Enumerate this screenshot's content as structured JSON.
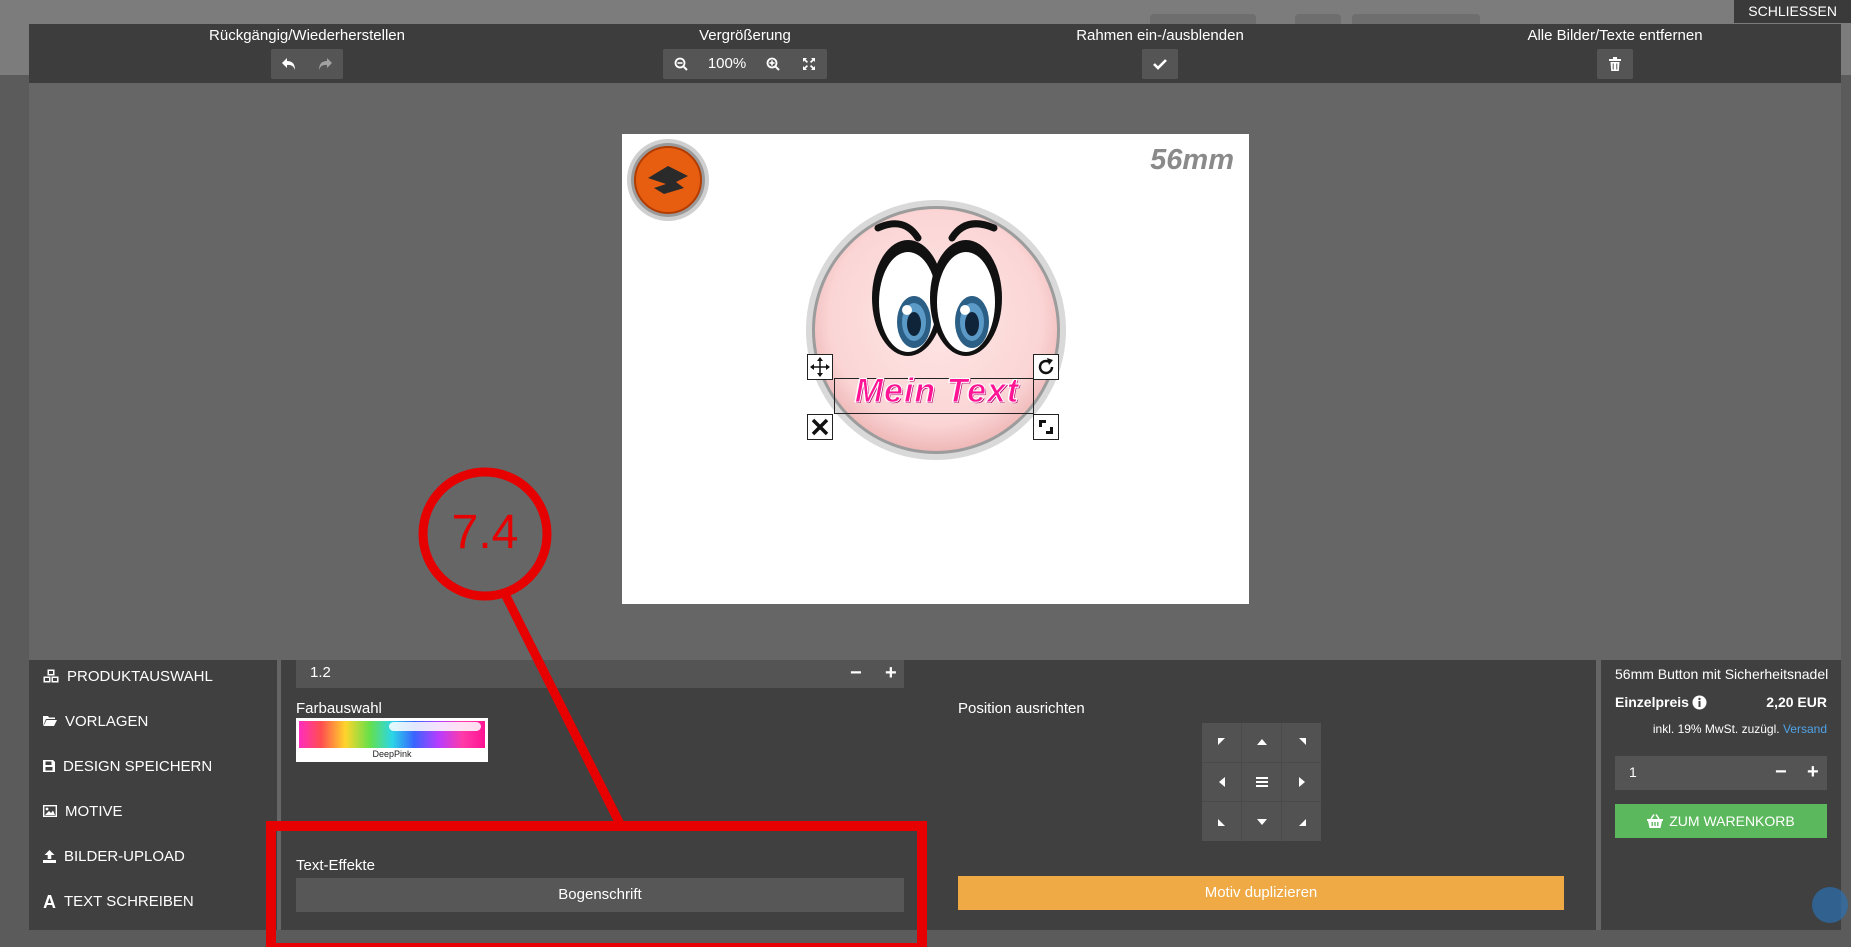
{
  "topbar": {
    "close_label": "SCHLIESSEN"
  },
  "toolbar": {
    "undo_group_label": "Rückgängig/Wiederherstellen",
    "zoom_group_label": "Vergrößerung",
    "zoom_value": "100%",
    "frame_group_label": "Rahmen ein-/ausblenden",
    "clear_group_label": "Alle Bilder/Texte entfernen"
  },
  "canvas": {
    "size_label": "56mm",
    "text_object": "Mein Text",
    "text_color": "#ff1493"
  },
  "menu": {
    "items": [
      {
        "label": "PRODUKTAUSWAHL",
        "icon": "cubes-icon"
      },
      {
        "label": "VORLAGEN",
        "icon": "folder-open-icon"
      },
      {
        "label": "DESIGN SPEICHERN",
        "icon": "save-icon"
      },
      {
        "label": "MOTIVE",
        "icon": "image-icon"
      },
      {
        "label": "BILDER-UPLOAD",
        "icon": "upload-icon"
      },
      {
        "label": "TEXT SCHREIBEN",
        "icon": "font-icon"
      }
    ]
  },
  "props": {
    "line_height_value": "1.2",
    "color_label": "Farbauswahl",
    "color_name": "DeepPink",
    "effects_label": "Text-Effekte",
    "arc_text_button": "Bogenschrift",
    "position_label": "Position ausrichten",
    "duplicate_button": "Motiv duplizieren"
  },
  "cart": {
    "product_name": "56mm Button mit Sicherheitsnadel",
    "price_label": "Einzelpreis",
    "price_value": "2,20 EUR",
    "tax_note": "inkl. 19% MwSt. zuzügl.",
    "shipping_link": "Versand",
    "quantity": "1",
    "add_to_cart": "ZUM WARENKORB",
    "add_to_cart_color": "#5cb85c"
  },
  "annotation": {
    "step_label": "7.4",
    "color": "#e60000"
  }
}
